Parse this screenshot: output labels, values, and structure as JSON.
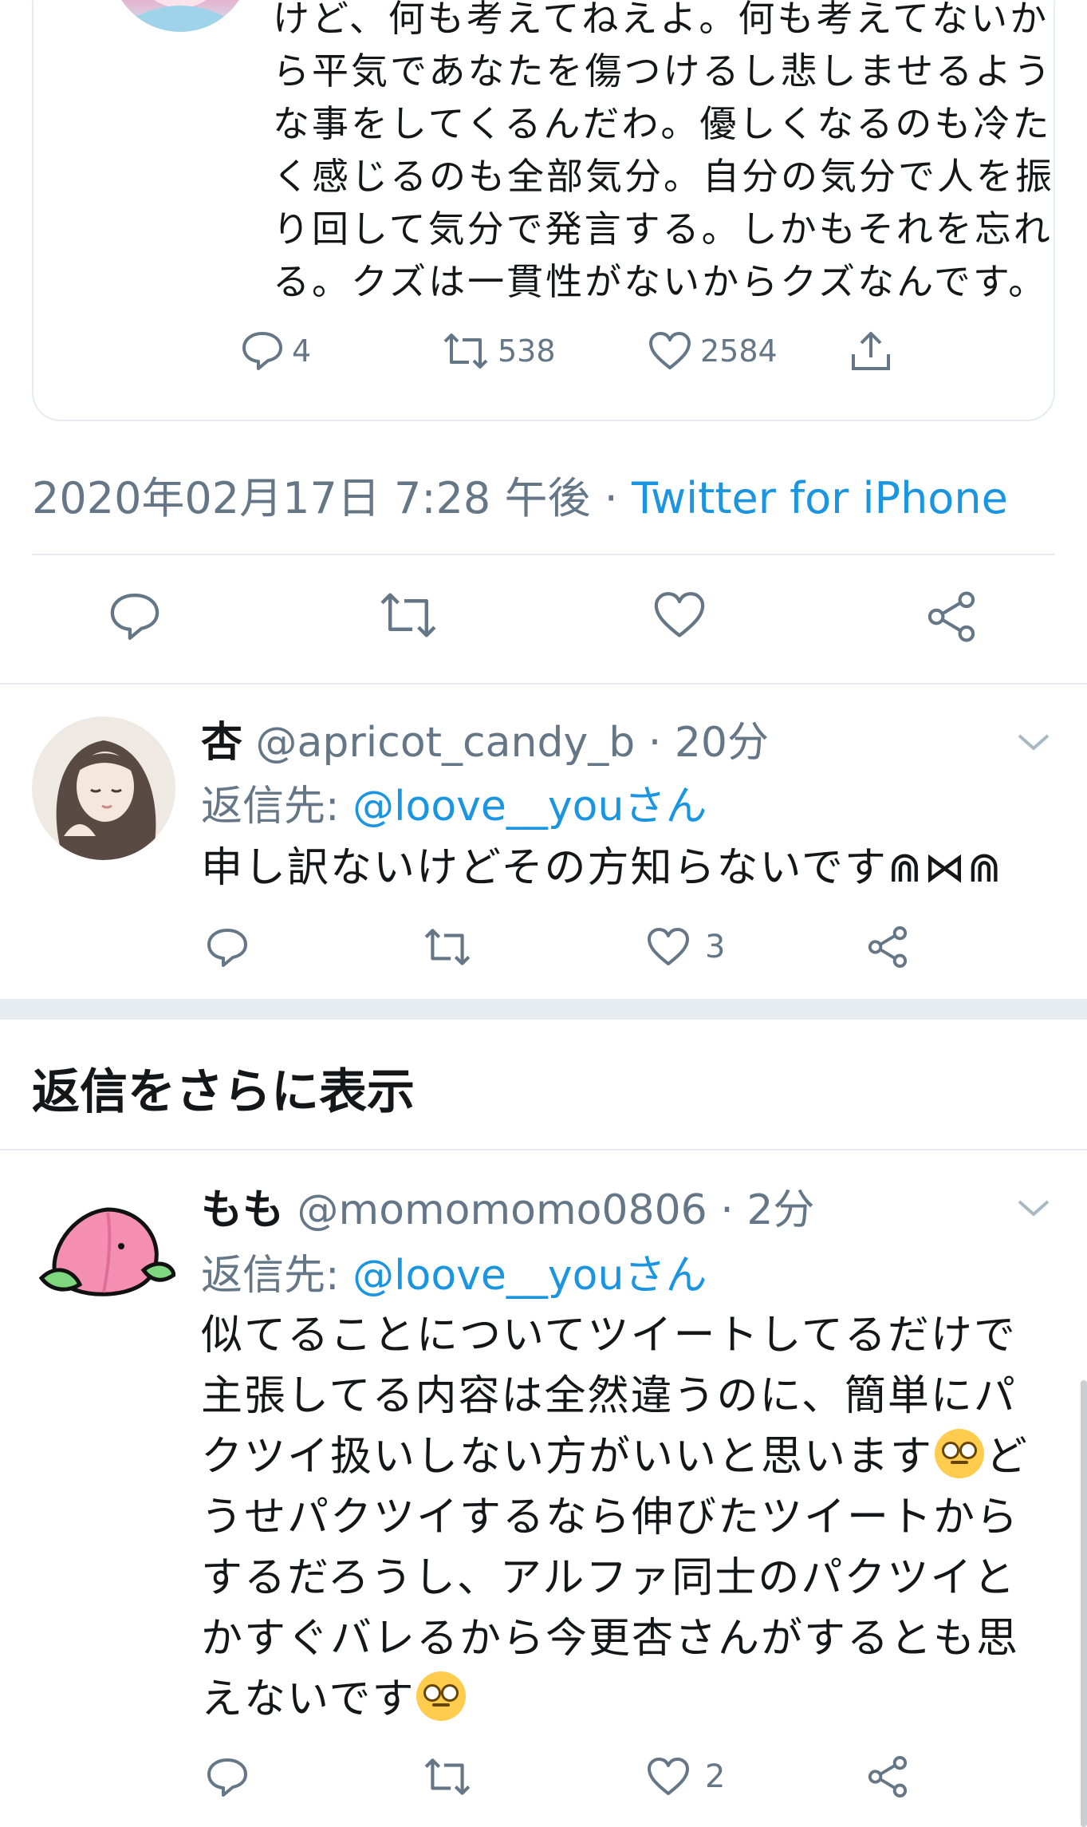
{
  "quoted_tweet": {
    "text_lines": [
      "けど、何も考えてねえよ。何も考えてないか",
      "ら平気であなたを傷つけるし悲しませるよう",
      "な事をしてくるんだわ。優しくなるのも冷た",
      "く感じるのも全部気分。自分の気分で人を振",
      "り回して気分で発言する。しかもそれを忘れ",
      "る。クズは一貫性がないからクズなんです。"
    ],
    "reply_count": "4",
    "retweet_count": "538",
    "like_count": "2584"
  },
  "main_tweet": {
    "timestamp": "2020年02月17日 7:28 午後 · ",
    "source": "Twitter for iPhone"
  },
  "replies": [
    {
      "display_name": "杏",
      "handle_time": " @apricot_candy_b · 20分",
      "reply_to_label": "返信先: ",
      "reply_to_user": "@loove__youさん",
      "text_lines": [
        "申し訳ないけどその方知らないです⋒⋈⋒"
      ],
      "like_count": "3"
    },
    {
      "display_name": "もも",
      "handle_time": " @momomomo0806 · 2分",
      "reply_to_label": "返信先: ",
      "reply_to_user": "@loove__youさん",
      "text_lines": [
        "似てることについてツイートしてるだけで",
        "主張してる内容は全然違うのに、簡単にパ",
        "クツイ扱いしない方がいいと思います",
        "うせパクツイするなら伸びたツイートから",
        "するだろうし、アルファ同士のパクツイと",
        "かすぐバレるから今更杏さんがするとも思",
        "えないです"
      ],
      "text_line_3_tail": "ど",
      "like_count": "2"
    }
  ],
  "section_header": "返信をさらに表示",
  "emoji_name": "face-with-rolling-eyes",
  "colors": {
    "link": "#1b95e0",
    "secondary": "#657786",
    "border": "#e6ecf0"
  }
}
